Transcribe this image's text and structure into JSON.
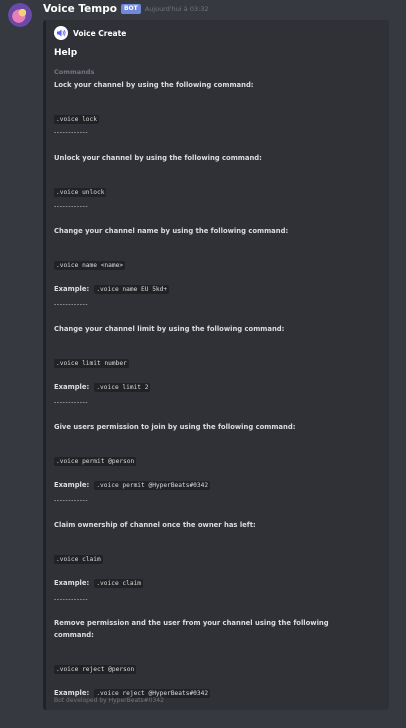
{
  "message": {
    "username": "Voice Tempo",
    "badge": "BOT",
    "timestamp": "Aujourd'hui à 03:32"
  },
  "embed": {
    "author": "Voice Create",
    "title": "Help",
    "field_name": "Commands",
    "sections": [
      {
        "text": "Lock your channel by using the following command:",
        "code": ".voice lock"
      },
      {
        "text": "Unlock your channel by using the following command:",
        "code": ".voice unlock"
      },
      {
        "text": "Change your channel name by using the following command:",
        "code": ".voice name <name>",
        "example_label": "Example:",
        "example": ".voice name EU 5kd+"
      },
      {
        "text": "Change your channel limit by using the following command:",
        "code": ".voice limit number",
        "example_label": "Example:",
        "example": ".voice limit 2"
      },
      {
        "text": "Give users permission to join by using the following command:",
        "code": ".voice permit @person",
        "example_label": "Example:",
        "example": ".voice permit @HyperBeats#0342"
      },
      {
        "text": "Claim ownership of channel once the owner has left:",
        "code": ".voice claim",
        "example_label": "Example:",
        "example": ".voice claim"
      },
      {
        "text_line1": "Remove permission and the user from your channel using the following",
        "text_line2": "command:",
        "code": ".voice reject @person",
        "example_label": "Example:",
        "example": ".voice reject @HyperBeats#0342"
      }
    ],
    "separator": "------------",
    "footer": "Bot developed by HyperBeats#0342"
  }
}
